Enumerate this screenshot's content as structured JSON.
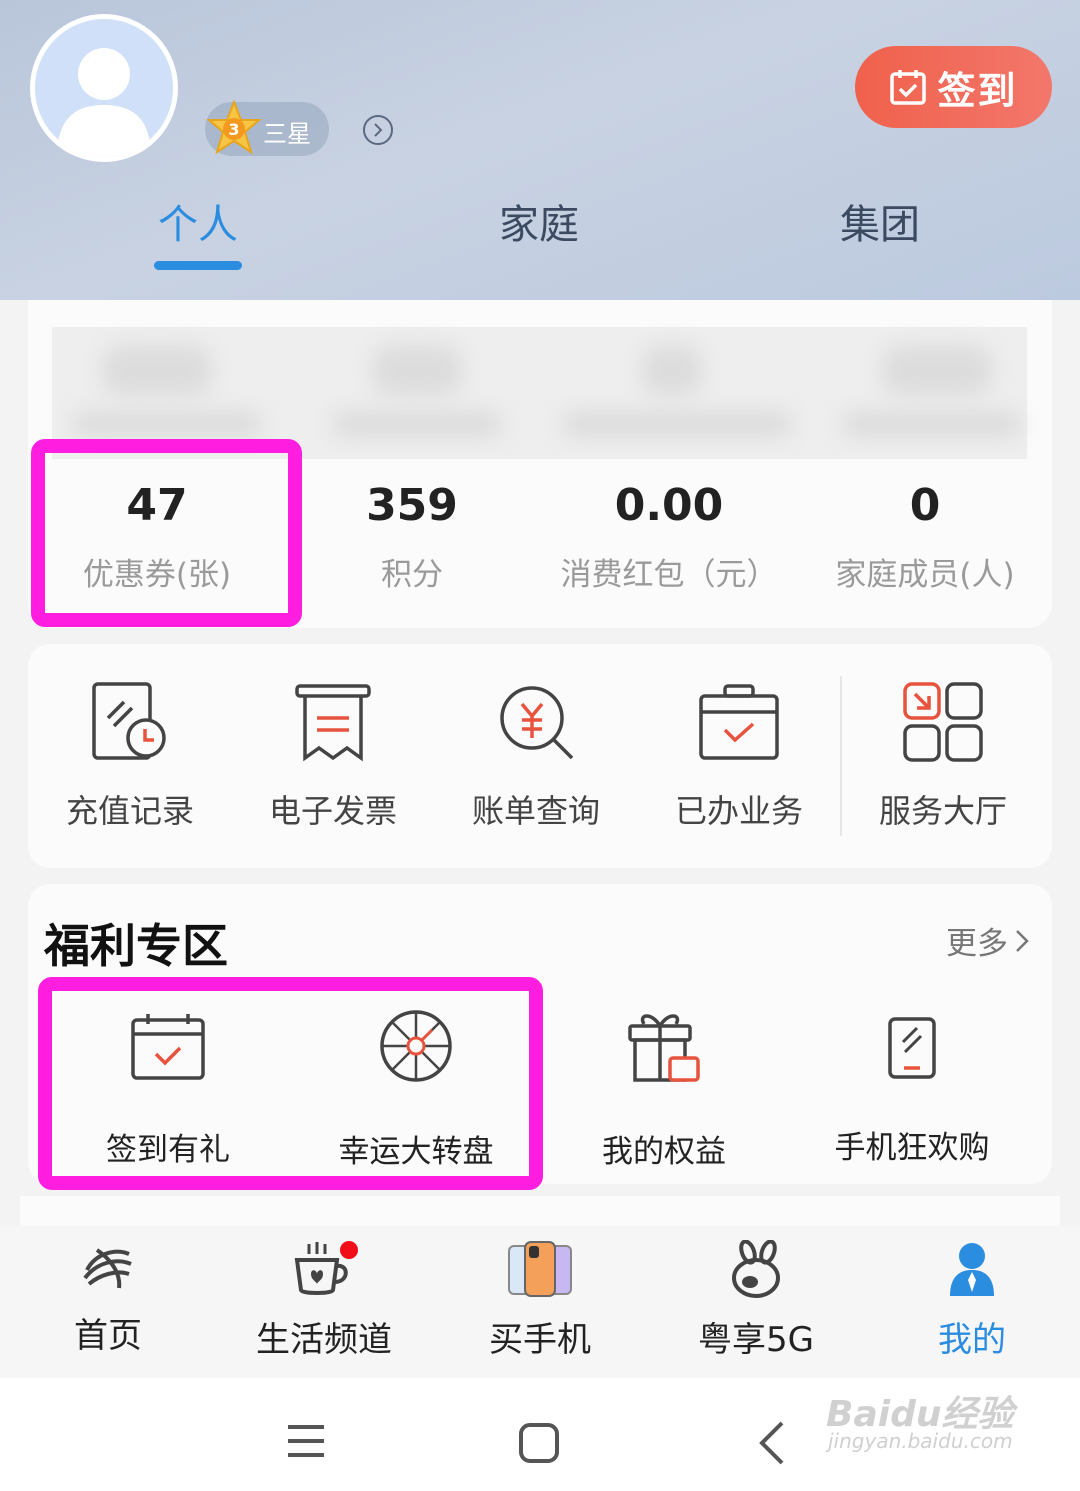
{
  "header": {
    "level_badge": "三星",
    "level_number": "3",
    "signin_label": "签到",
    "tabs": [
      "个人",
      "家庭",
      "集团"
    ]
  },
  "stats": [
    {
      "value": "47",
      "label": "优惠券(张)"
    },
    {
      "value": "359",
      "label": "积分"
    },
    {
      "value": "0.00",
      "label": "消费红包（元）"
    },
    {
      "value": "0",
      "label": "家庭成员(人)"
    }
  ],
  "services": [
    "充值记录",
    "电子发票",
    "账单查询",
    "已办业务",
    "服务大厅"
  ],
  "welfare": {
    "title": "福利专区",
    "more": "更多",
    "items": [
      "签到有礼",
      "幸运大转盘",
      "我的权益",
      "手机狂欢购"
    ]
  },
  "bottom_nav": [
    "首页",
    "生活频道",
    "买手机",
    "粤享5G",
    "我的"
  ],
  "watermark": {
    "main": "Baidu经验",
    "sub": "jingyan.baidu.com"
  },
  "colors": {
    "accent": "#2b8de0",
    "highlight": "#ff1ee0",
    "signin": "#f0614c"
  }
}
